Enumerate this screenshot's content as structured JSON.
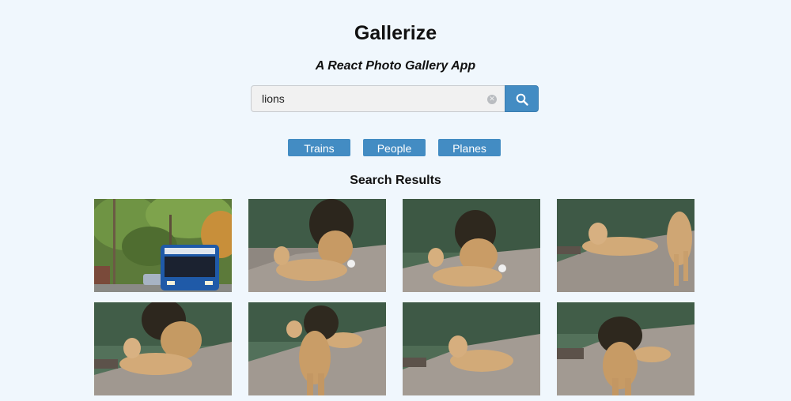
{
  "header": {
    "title": "Gallerize",
    "subtitle": "A React Photo Gallery App"
  },
  "search": {
    "value": "lions",
    "clear_icon": "clear-circle-icon",
    "button_icon": "search-icon"
  },
  "nav": {
    "buttons": [
      "Trains",
      "People",
      "Planes"
    ]
  },
  "results": {
    "heading": "Search Results",
    "photos": [
      {
        "subject": "bus"
      },
      {
        "subject": "lions"
      },
      {
        "subject": "lions"
      },
      {
        "subject": "lions"
      },
      {
        "subject": "lions"
      },
      {
        "subject": "lions"
      },
      {
        "subject": "lions"
      },
      {
        "subject": "lions"
      }
    ]
  },
  "colors": {
    "background": "#f0f7fd",
    "accent": "#438cc3"
  }
}
